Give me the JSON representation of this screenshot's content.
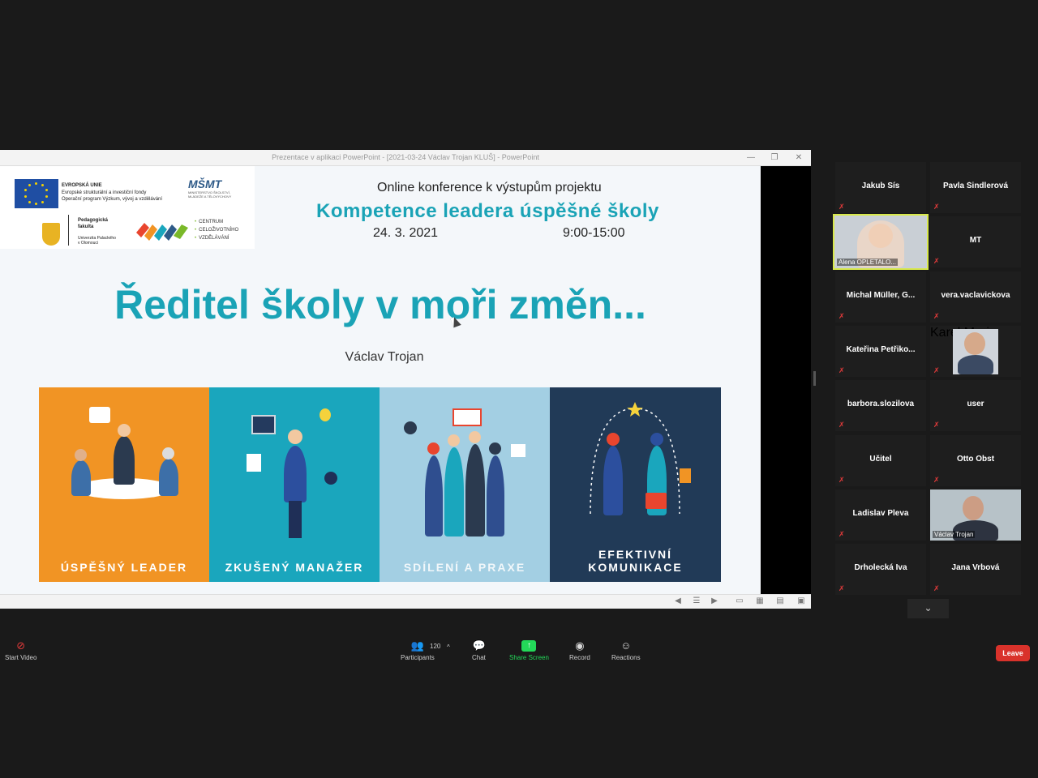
{
  "ppt_window": {
    "title": "Prezentace v aplikaci PowerPoint - [2021-03-24 Václav Trojan KLUŠ] - PowerPoint",
    "minimize_glyph": "—",
    "restore_glyph": "❐",
    "close_glyph": "✕"
  },
  "slide": {
    "logos": {
      "eu_line1": "EVROPSKÁ UNIE",
      "eu_line2": "Evropské strukturální a investiční fondy",
      "eu_line3": "Operační program Výzkum, vývoj a vzdělávání",
      "msmt_mark": "MŠMT",
      "msmt_sub": "MINISTERSTVO ŠKOLSTVÍ, MLÁDEŽE A TĚLOVÝCHOVY",
      "faculty_line1": "Pedagogická",
      "faculty_line2": "fakulta",
      "university_line1": "Univerzita Palackého",
      "university_line2": "v Olomouci",
      "ccv_line1": "CENTRUM",
      "ccv_line2": "CELOŽIVOTNÍHO",
      "ccv_line3": "VZDĚLÁVÁNÍ"
    },
    "conference_line": "Online konference k výstupům projektu",
    "conference_title": "Kompetence leadera úspěšné školy",
    "date": "24. 3. 2021",
    "time": "9:00-15:00",
    "main_title": "Ředitel školy v moři změn...",
    "author": "Václav Trojan",
    "panels": [
      {
        "label": "ÚSPĚŠNÝ LEADER",
        "color": "#f19424"
      },
      {
        "label": "ZKUŠENÝ MANAŽER",
        "color": "#1aa6bd"
      },
      {
        "label": "SDÍLENÍ A PRAXE",
        "color": "#a3cfe3"
      },
      {
        "label": "EFEKTIVNÍ KOMUNIKACE",
        "color": "#213a57"
      }
    ]
  },
  "gallery": {
    "participants": [
      {
        "name": "Jakub Sís",
        "video": false
      },
      {
        "name": "Pavla Šindlerová",
        "video": false
      },
      {
        "name": "Alena OPLETALO...",
        "video": true,
        "active": true
      },
      {
        "name": "MT",
        "video": false
      },
      {
        "name": "Michal Müller, G...",
        "video": false
      },
      {
        "name": "vera.vaclavickova",
        "video": false
      },
      {
        "name": "Kateřina Petřiko...",
        "video": false
      },
      {
        "name": "Karel Moric",
        "video": true
      },
      {
        "name": "barbora.slozilova",
        "video": false
      },
      {
        "name": "user",
        "video": false
      },
      {
        "name": "Učitel",
        "video": false
      },
      {
        "name": "Otto Obst",
        "video": false
      },
      {
        "name": "Ladislav Pleva",
        "video": false
      },
      {
        "name": "Václav Trojan",
        "video": true
      },
      {
        "name": "Drholecká Iva",
        "video": false
      },
      {
        "name": "Jana Vrbová",
        "video": false
      }
    ],
    "more_glyph": "⌄"
  },
  "toolbar": {
    "start_video": "Start Video",
    "participants": "Participants",
    "participants_count": "120",
    "participants_caret": "^",
    "chat": "Chat",
    "share_screen": "Share Screen",
    "record": "Record",
    "reactions": "Reactions",
    "leave": "Leave",
    "share_color": "#23d959",
    "leave_color": "#d9322b"
  }
}
